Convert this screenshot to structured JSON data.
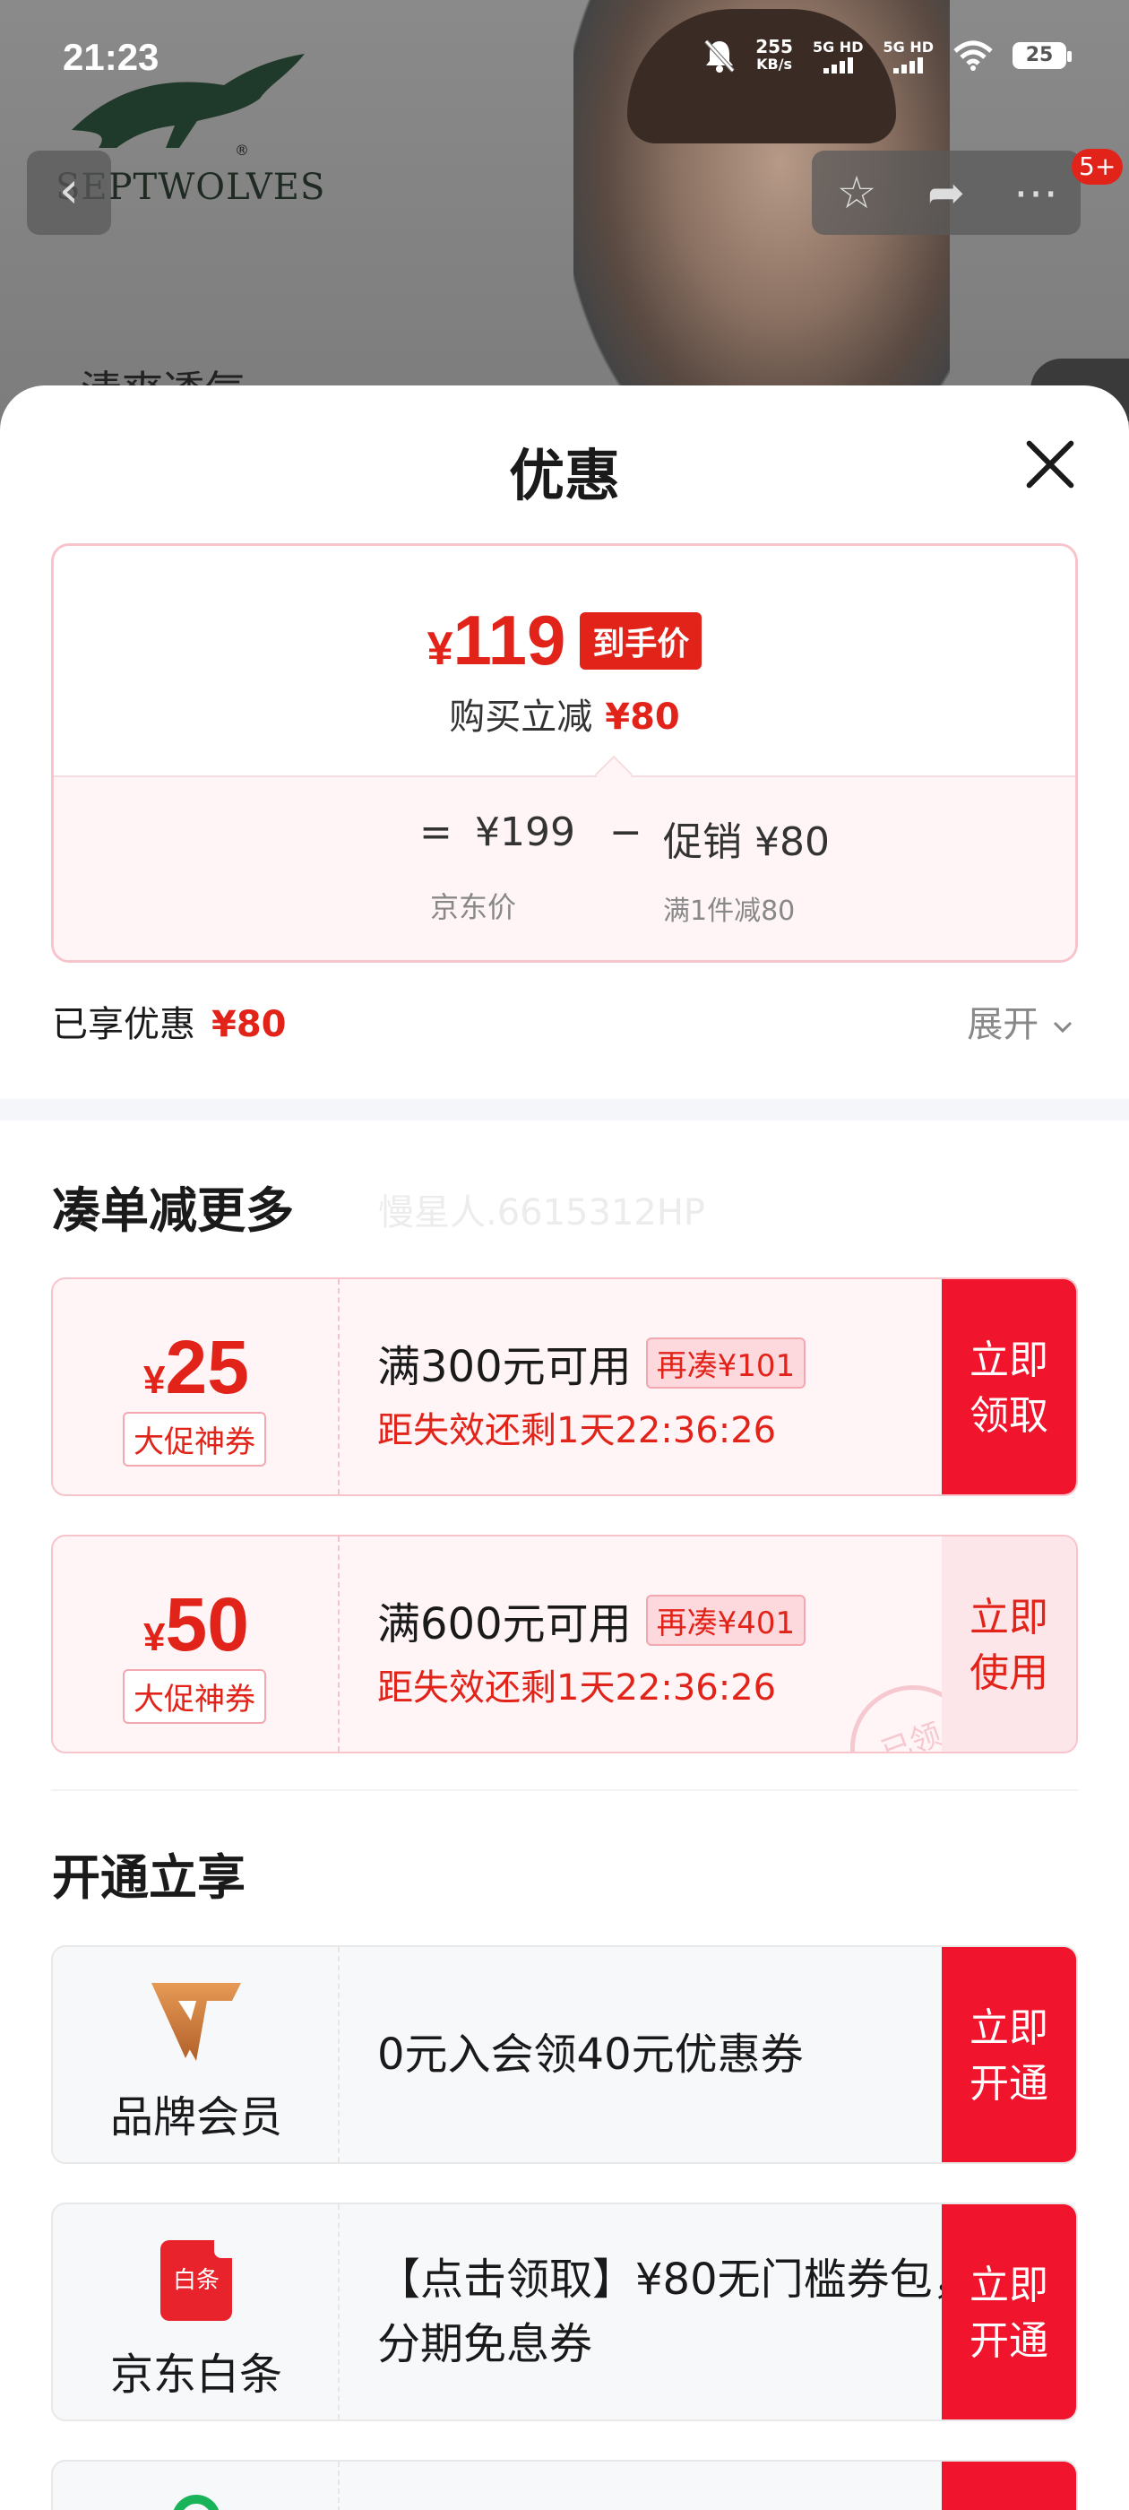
{
  "status_bar": {
    "time": "21:23",
    "speed_value": "255",
    "speed_unit": "KB/s",
    "net1": "5G HD",
    "net2": "5G HD",
    "battery": "25"
  },
  "background": {
    "brand_name": "SEPTWOLVES",
    "peek_text": "清爽透气",
    "cart_badge": "5+"
  },
  "sheet": {
    "title": "优惠",
    "price_box": {
      "currency": "¥",
      "final_price": "119",
      "final_tag": "到手价",
      "cut_label": "购买立减",
      "cut_amount": "¥80",
      "eq": "=",
      "base_price": "¥199",
      "minus": "−",
      "promo": "促销 ¥80",
      "base_label": "京东价",
      "promo_label": "满1件减80"
    },
    "enjoyed_label": "已享优惠",
    "enjoyed_amount": "¥80",
    "expand_label": "展开"
  },
  "more_section": {
    "title": "凑单减更多",
    "watermark": "慢星人.6615312HP",
    "coupons": [
      {
        "currency": "¥",
        "value": "25",
        "kind": "大促神券",
        "condition": "满300元可用",
        "extra": "再凑¥101",
        "countdown": "距失效还剩1天22:36:26",
        "action_line1": "立即",
        "action_line2": "领取"
      },
      {
        "currency": "¥",
        "value": "50",
        "kind": "大促神券",
        "condition": "满600元可用",
        "extra": "再凑¥401",
        "countdown": "距失效还剩1天22:36:26",
        "action_line1": "立即",
        "action_line2": "使用",
        "stamp": "已领"
      }
    ]
  },
  "open_section": {
    "title": "开通立享",
    "items": [
      {
        "icon": "brand-member-v-icon",
        "label": "品牌会员",
        "desc": "0元入会领40元优惠券",
        "action_line1": "立即",
        "action_line2": "开通"
      },
      {
        "icon": "baitiao-icon",
        "icon_text": "白条",
        "label": "京东白条",
        "desc_line1": "【点击领取】¥80无门槛券包，",
        "desc_line2": "分期免息券",
        "action_line1": "立即",
        "action_line2": "开通"
      }
    ]
  },
  "colors": {
    "accent": "#e2231a",
    "action": "#f0142d"
  }
}
